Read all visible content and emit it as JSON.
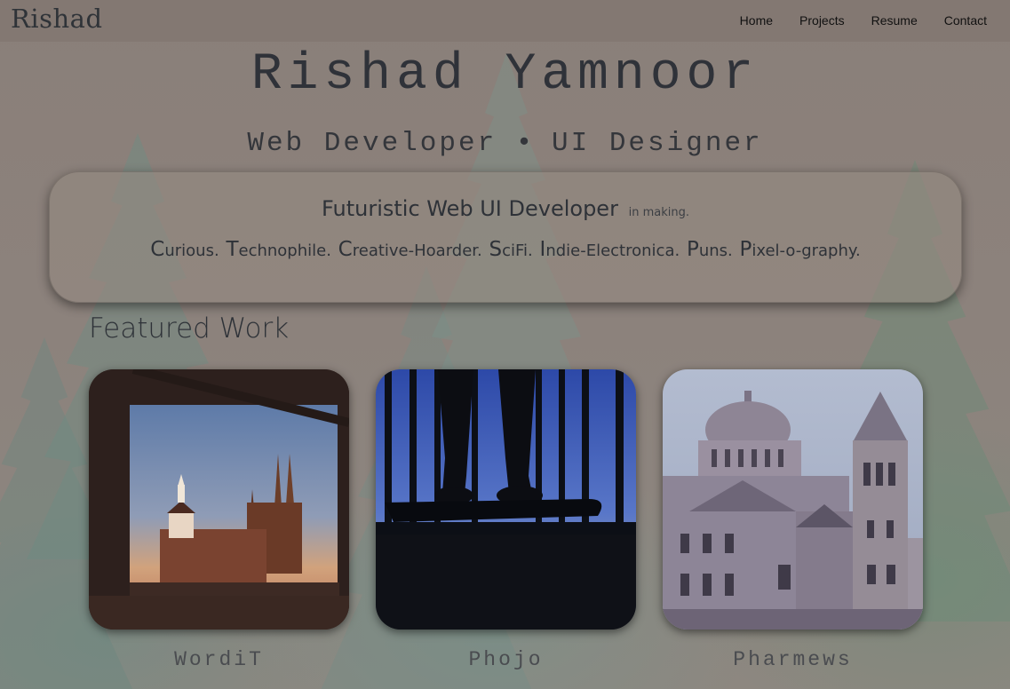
{
  "nav": {
    "brand": "Rishad",
    "links": [
      "Home",
      "Projects",
      "Resume",
      "Contact"
    ]
  },
  "hero": {
    "name": "Rishad Yamnoor",
    "subtitle_left": "Web Developer",
    "subtitle_sep": "•",
    "subtitle_right": "UI Designer"
  },
  "intro": {
    "title": "Futuristic Web UI Developer",
    "title_suffix": "in making.",
    "traits": [
      {
        "cap": "C",
        "rest": "urious."
      },
      {
        "cap": "T",
        "rest": "echnophile."
      },
      {
        "cap": "C",
        "rest": "reative-Hoarder."
      },
      {
        "cap": "S",
        "rest": "ciFi."
      },
      {
        "cap": "I",
        "rest": "ndie-Electronica."
      },
      {
        "cap": "P",
        "rest": "uns."
      },
      {
        "cap": "P",
        "rest": "ixel-o-graphy."
      }
    ]
  },
  "featured": {
    "title": "Featured Work",
    "items": [
      {
        "label": "WordiT",
        "thumb": "church-through-window-photo"
      },
      {
        "label": "Phojo",
        "thumb": "skateboard-silhouette-photo"
      },
      {
        "label": "Pharmews",
        "thumb": "domed-cathedral-photo"
      }
    ]
  },
  "colors": {
    "text_dark": "#2e3238",
    "navbar_bg": "#80766f",
    "tree_green": "#6c8c84"
  }
}
